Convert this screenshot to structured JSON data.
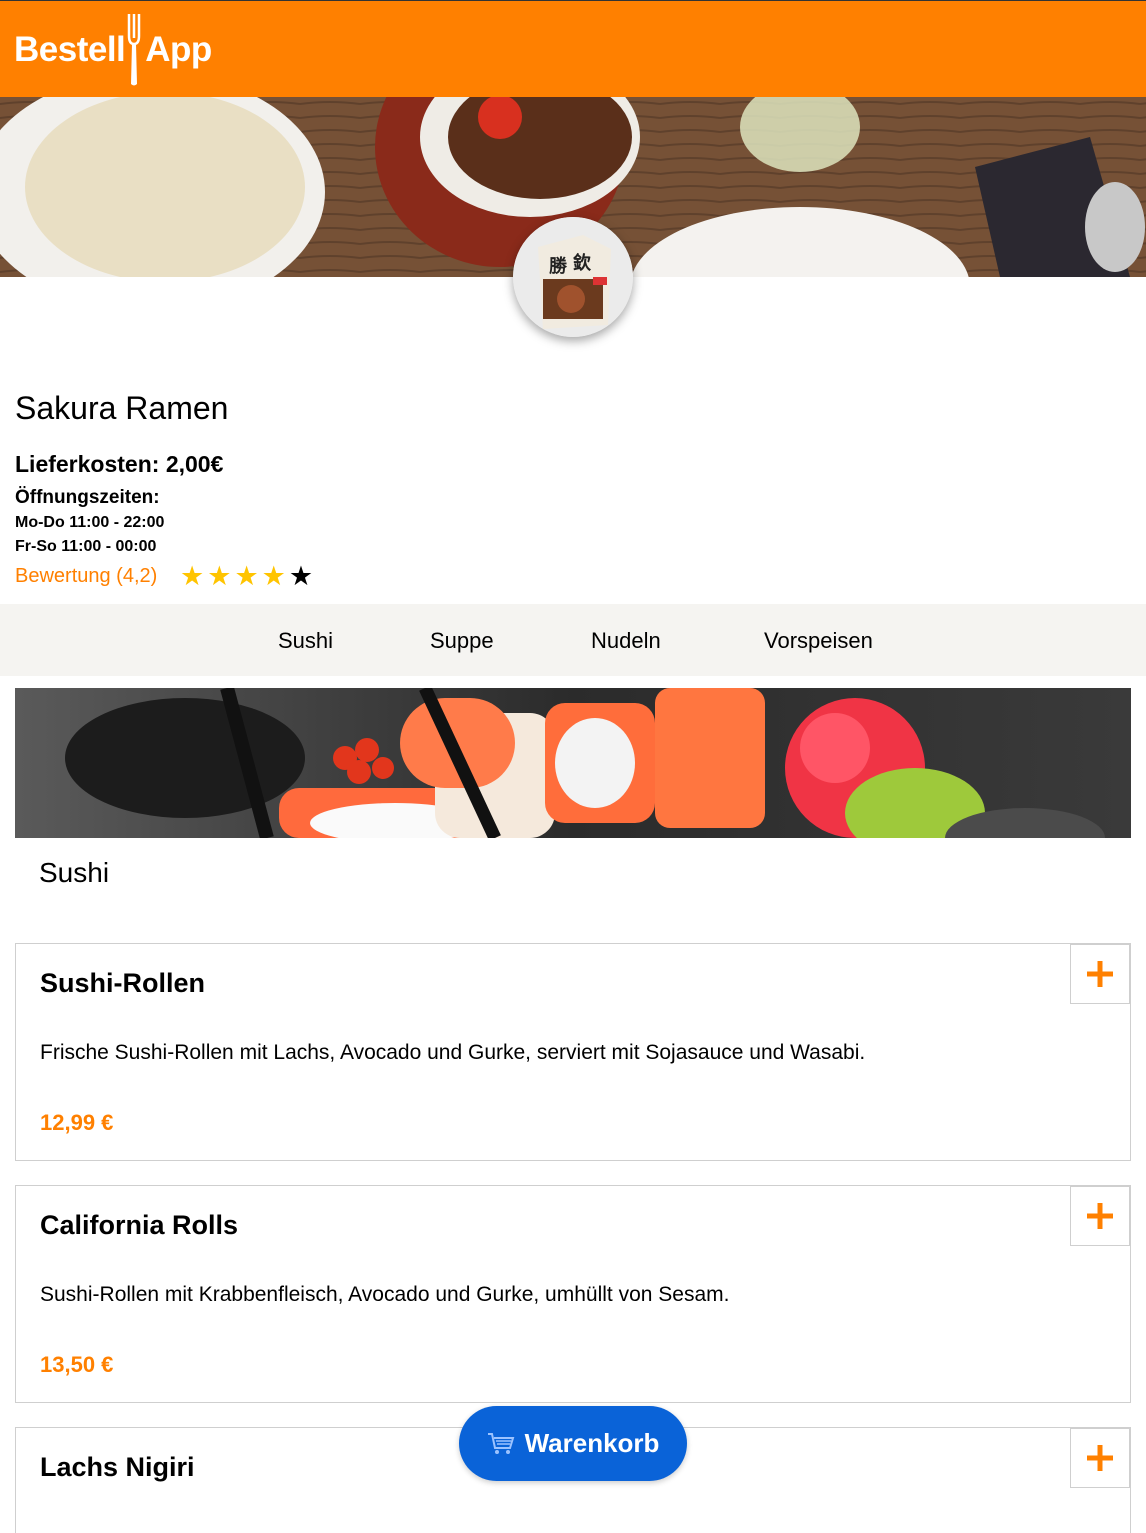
{
  "app": {
    "logo_text_1": "Bestell",
    "logo_text_2": "App"
  },
  "restaurant": {
    "name": "Sakura Ramen",
    "delivery_cost": "Lieferkosten: 2,00€",
    "hours_label": "Öffnungszeiten:",
    "hours": [
      "Mo-Do 11:00 - 22:00",
      "Fr-So 11:00 - 00:00"
    ],
    "rating_label": "Bewertung (4,2)",
    "rating_stars": 4,
    "rating_max": 5
  },
  "categories": [
    {
      "label": "Sushi"
    },
    {
      "label": "Suppe"
    },
    {
      "label": "Nudeln"
    },
    {
      "label": "Vorspeisen"
    }
  ],
  "section": {
    "title": "Sushi"
  },
  "dishes": [
    {
      "name": "Sushi-Rollen",
      "description": "Frische Sushi-Rollen mit Lachs, Avocado und Gurke, serviert mit Sojasauce und Wasabi.",
      "price": "12,99 €"
    },
    {
      "name": "California Rolls",
      "description": "Sushi-Rollen mit Krabbenfleisch, Avocado und Gurke, umhüllt von Sesam.",
      "price": "13,50 €"
    },
    {
      "name": "Lachs Nigiri",
      "description": "",
      "price": ""
    }
  ],
  "cart": {
    "label": "Warenkorb",
    "icon": "shopping-cart-icon"
  },
  "colors": {
    "brand": "#ff8000",
    "cart": "#0a63d8",
    "nav_bg": "#f5f4f1",
    "star": "#ffc400"
  }
}
